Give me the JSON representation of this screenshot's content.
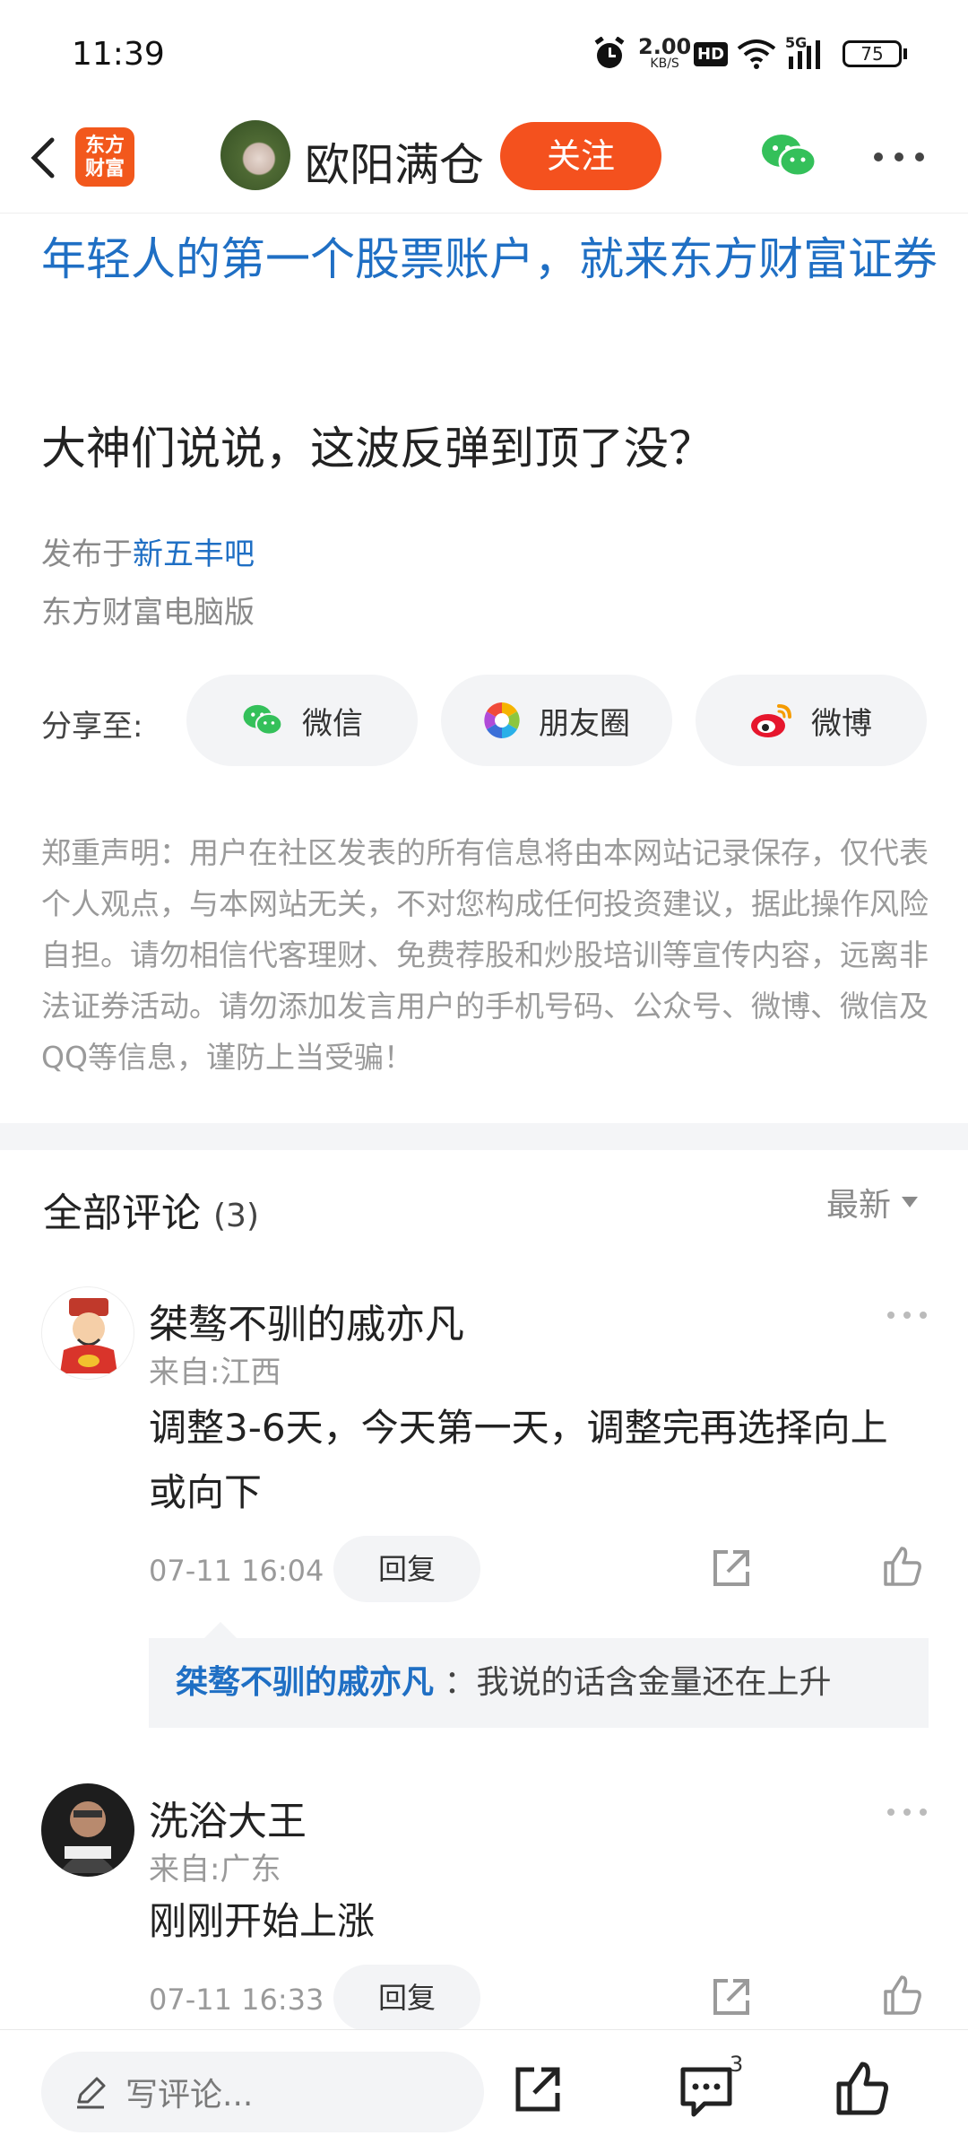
{
  "status_bar": {
    "time": "11:39",
    "speed_value": "2.00",
    "speed_unit": "KB/S",
    "hd": "HD",
    "network": "5G",
    "battery": "75",
    "icons": [
      "alarm-icon",
      "hd-icon",
      "wifi-icon",
      "signal-icon",
      "battery-icon"
    ]
  },
  "nav": {
    "app_logo_line1": "东方",
    "app_logo_line2": "财富",
    "author_name": "欧阳满仓",
    "follow_label": "关注"
  },
  "article": {
    "ad_link": "年轻人的第一个股票账户，就来东方财富证券",
    "title": "大神们说说，这波反弹到顶了没？",
    "published_prefix": "发布于",
    "published_bar": "新五丰吧",
    "source": "东方财富电脑版",
    "share_label": "分享至:",
    "share_targets": [
      {
        "label": "微信",
        "icon": "wechat-icon"
      },
      {
        "label": "朋友圈",
        "icon": "moments-icon"
      },
      {
        "label": "微博",
        "icon": "weibo-icon"
      }
    ],
    "disclaimer": "郑重声明：用户在社区发表的所有信息将由本网站记录保存，仅代表个人观点，与本网站无关，不对您构成任何投资建议，据此操作风险自担。请勿相信代客理财、免费荐股和炒股培训等宣传内容，远离非法证券活动。请勿添加发言用户的手机号码、公众号、微博、微信及QQ等信息，谨防上当受骗！"
  },
  "comments": {
    "title": "全部评论",
    "count": "(3)",
    "sort_label": "最新",
    "items": [
      {
        "author": "桀骜不驯的戚亦凡",
        "location": "来自:江西",
        "text": "调整3-6天，今天第一天，调整完再选择向上或向下",
        "time": "07-11 16:04",
        "reply_label": "回复",
        "reply": {
          "author": "桀骜不驯的戚亦凡",
          "text": "：我说的话含金量还在上升"
        }
      },
      {
        "author": "洗浴大王",
        "location": "来自:广东",
        "text": "刚刚开始上涨",
        "time": "07-11 16:33",
        "reply_label": "回复"
      }
    ]
  },
  "bottom_bar": {
    "write_placeholder": "写评论...",
    "comment_count": "3"
  },
  "colors": {
    "accent": "#f4511e",
    "link": "#1f6fc4",
    "muted": "#9a9a9a",
    "chip_bg": "#f3f4f6"
  }
}
